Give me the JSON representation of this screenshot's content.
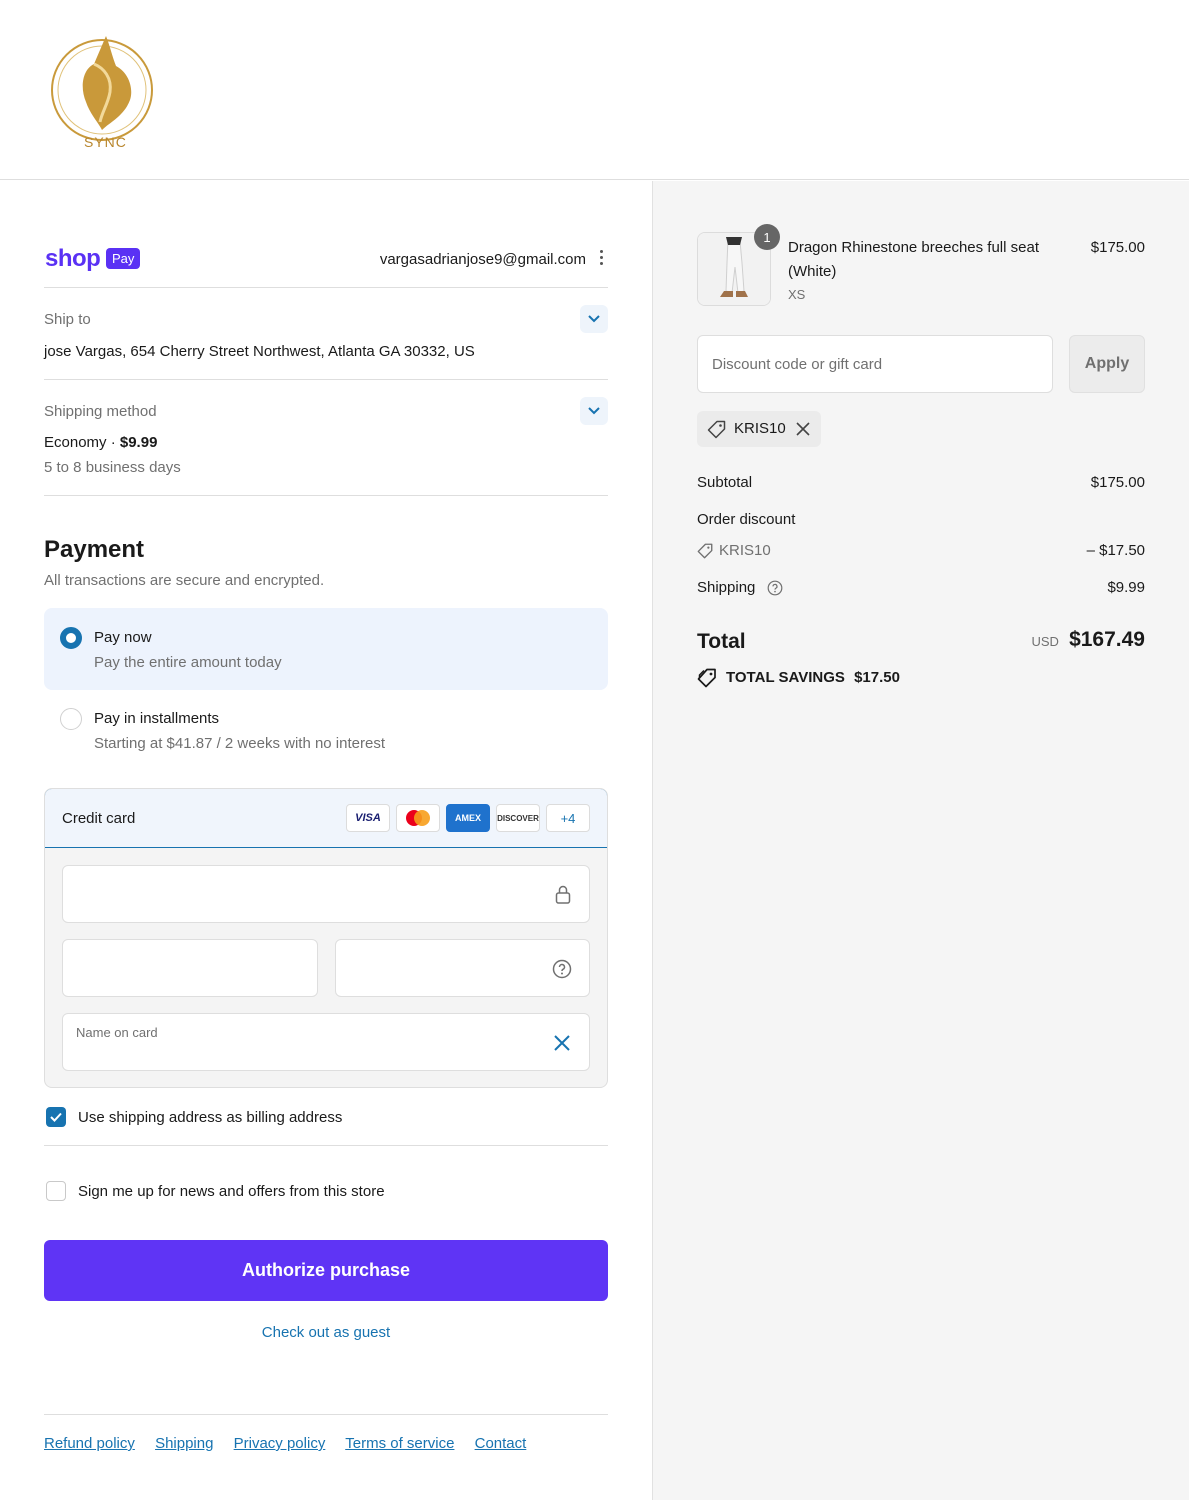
{
  "brand": {
    "logo_text": "SYNC"
  },
  "shop_pay": {
    "logo": "shop",
    "pay": "Pay",
    "email": "vargasadrianjose9@gmail.com"
  },
  "ship_to": {
    "label": "Ship to",
    "address": "jose Vargas, 654 Cherry Street Northwest, Atlanta GA 30332, US"
  },
  "shipping_method": {
    "label": "Shipping method",
    "name": "Economy",
    "separator": "·",
    "price": "$9.99",
    "eta": "5 to 8 business days"
  },
  "payment": {
    "title": "Payment",
    "subtitle": "All transactions are secure and encrypted.",
    "options": [
      {
        "title": "Pay now",
        "desc": "Pay the entire amount today",
        "selected": true
      },
      {
        "title": "Pay in installments",
        "desc": "Starting at $41.87 / 2 weeks with no interest",
        "selected": false
      }
    ],
    "credit_card": {
      "label": "Credit card",
      "brands": [
        "VISA",
        "Mastercard",
        "AMEX",
        "DISCOVER"
      ],
      "more": "+4",
      "name_placeholder": "Name on card"
    },
    "billing_same_label": "Use shipping address as billing address",
    "newsletter_label": "Sign me up for news and offers from this store",
    "authorize_label": "Authorize purchase",
    "guest_label": "Check out as guest"
  },
  "footer_links": [
    "Refund policy",
    "Shipping",
    "Privacy policy",
    "Terms of service",
    "Contact"
  ],
  "order": {
    "item": {
      "quantity": "1",
      "name_line1": "Dragon Rhinestone breeches full seat",
      "name_line2": "(White)",
      "variant": "XS",
      "price": "$175.00"
    },
    "discount_placeholder": "Discount code or gift card",
    "apply_label": "Apply",
    "applied_code": "KRIS10",
    "subtotal_label": "Subtotal",
    "subtotal": "$175.00",
    "order_discount_label": "Order discount",
    "discount_code": "KRIS10",
    "discount_amount": "– $17.50",
    "shipping_label": "Shipping",
    "shipping": "$9.99",
    "total_label": "Total",
    "currency": "USD",
    "total": "$167.49",
    "savings_label": "TOTAL SAVINGS",
    "savings": "$17.50"
  },
  "colors": {
    "accent": "#1773b0",
    "shop_purple": "#5a31f4",
    "button": "#5f34f5",
    "panel_bg": "#f5f5f5"
  }
}
